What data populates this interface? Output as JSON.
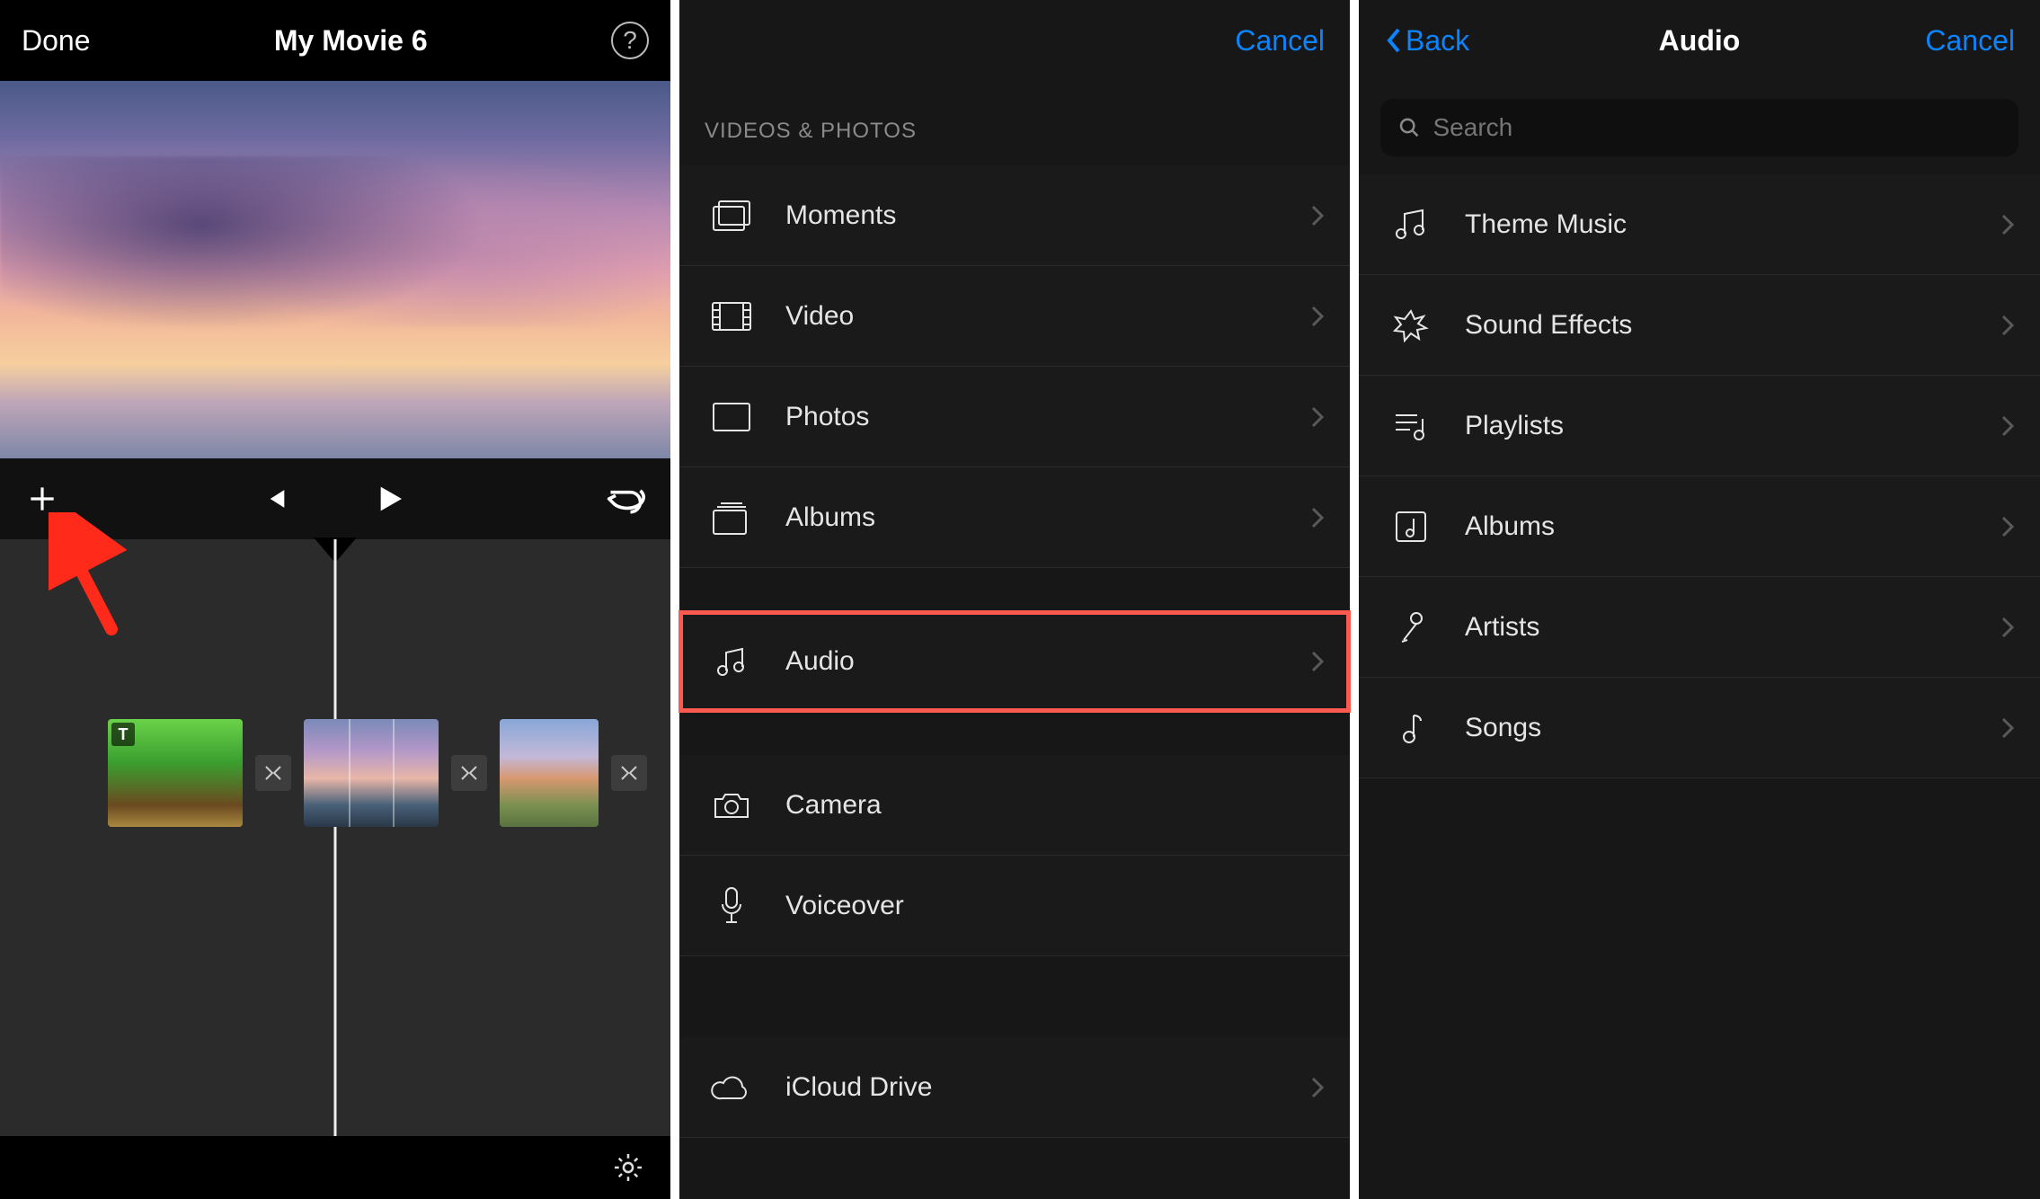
{
  "panel1": {
    "done": "Done",
    "title": "My Movie 6",
    "clip_text_badge": "T"
  },
  "panel2": {
    "cancel": "Cancel",
    "section_header": "VIDEOS & PHOTOS",
    "rows": {
      "moments": "Moments",
      "video": "Video",
      "photos": "Photos",
      "albums": "Albums",
      "audio": "Audio",
      "camera": "Camera",
      "voiceover": "Voiceover",
      "icloud": "iCloud Drive"
    }
  },
  "panel3": {
    "back": "Back",
    "title": "Audio",
    "cancel": "Cancel",
    "search_placeholder": "Search",
    "rows": {
      "theme": "Theme Music",
      "sfx": "Sound Effects",
      "playlists": "Playlists",
      "albums": "Albums",
      "artists": "Artists",
      "songs": "Songs"
    }
  }
}
